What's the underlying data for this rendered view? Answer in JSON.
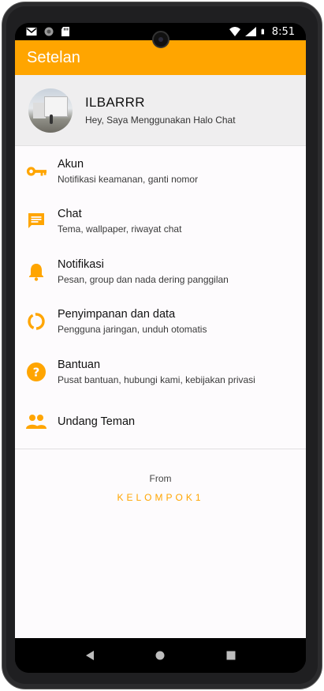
{
  "statusbar": {
    "time": "8:51",
    "left_icons": [
      "gmail-icon",
      "sync-icon",
      "sd-card-icon"
    ],
    "right_icons": [
      "wifi-icon",
      "signal-icon",
      "battery-icon"
    ]
  },
  "appbar": {
    "title": "Setelan"
  },
  "profile": {
    "name": "ILBARRR",
    "status": "Hey, Saya Menggunakan Halo Chat"
  },
  "menu": [
    {
      "title": "Akun",
      "subtitle": "Notifikasi keamanan, ganti nomor",
      "icon": "key-icon"
    },
    {
      "title": "Chat",
      "subtitle": "Tema, wallpaper, riwayat chat",
      "icon": "chat-icon"
    },
    {
      "title": "Notifikasi",
      "subtitle": "Pesan, group dan nada dering panggilan",
      "icon": "bell-icon"
    },
    {
      "title": "Penyimpanan dan data",
      "subtitle": "Pengguna jaringan, unduh otomatis",
      "icon": "data-usage-icon"
    },
    {
      "title": "Bantuan",
      "subtitle": "Pusat bantuan, hubungi kami, kebijakan privasi",
      "icon": "help-icon"
    },
    {
      "title": "Undang Teman",
      "subtitle": "",
      "icon": "people-icon"
    }
  ],
  "footer": {
    "from": "From",
    "brand": "KELOMPOK1"
  },
  "colors": {
    "accent": "#ffa500",
    "background": "#fdfbfd",
    "profile_bg": "#efeeef"
  },
  "navbar": {
    "buttons": [
      "back-icon",
      "home-icon",
      "recents-icon"
    ]
  }
}
